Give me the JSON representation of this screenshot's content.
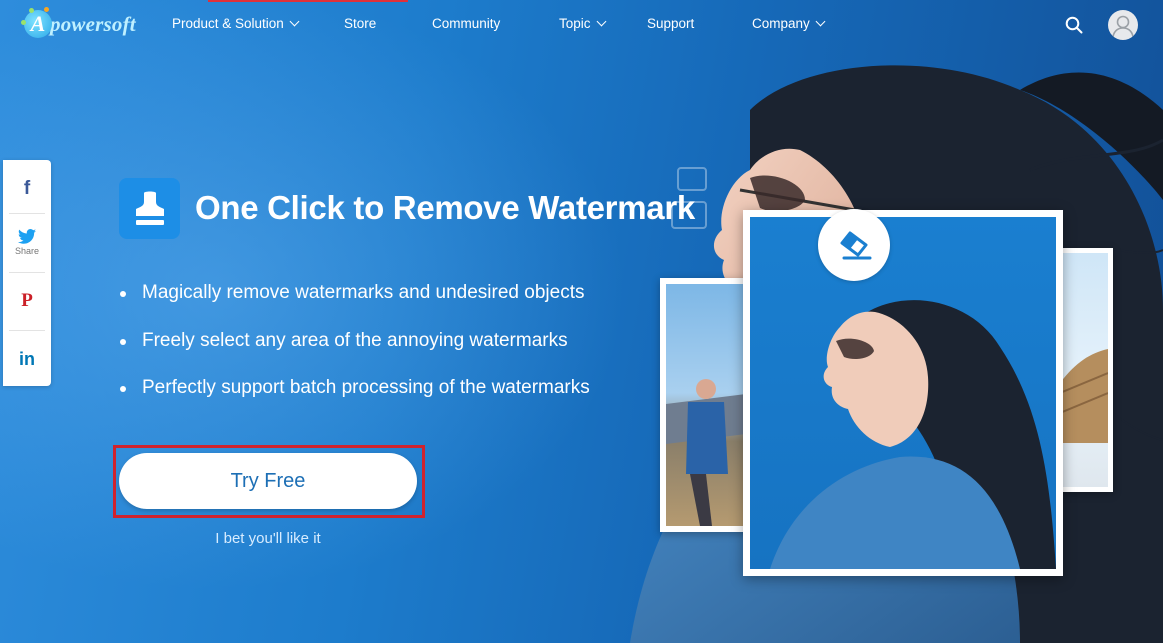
{
  "brand": {
    "name": "powersoft",
    "initial": "A"
  },
  "nav": {
    "items": [
      {
        "label": "Product & Solution",
        "has_dropdown": true
      },
      {
        "label": "Store",
        "has_dropdown": false
      },
      {
        "label": "Community",
        "has_dropdown": false
      },
      {
        "label": "Topic",
        "has_dropdown": true
      },
      {
        "label": "Support",
        "has_dropdown": false
      },
      {
        "label": "Company",
        "has_dropdown": true
      }
    ],
    "search_icon": "search-icon",
    "avatar_icon": "user-avatar-icon"
  },
  "share": {
    "label": "Share",
    "networks": [
      "facebook",
      "twitter",
      "pinterest",
      "linkedin"
    ],
    "facebook_glyph": "f",
    "pinterest_glyph": "P",
    "linkedin_glyph": "in"
  },
  "hero": {
    "headline": "One Click to Remove Watermark",
    "features": [
      "Magically remove watermarks and undesired objects",
      "Freely select any area of the annoying watermarks",
      "Perfectly support batch processing of the watermarks"
    ],
    "cta_label": "Try Free",
    "tagline": "I bet you'll like it"
  },
  "colors": {
    "background": "#1d7ccc",
    "accent_red": "#d0232e",
    "cta_text": "#1d6fb5",
    "facebook": "#3b5998",
    "twitter": "#1da1f2",
    "pinterest": "#cb2027",
    "linkedin": "#0077b5"
  }
}
